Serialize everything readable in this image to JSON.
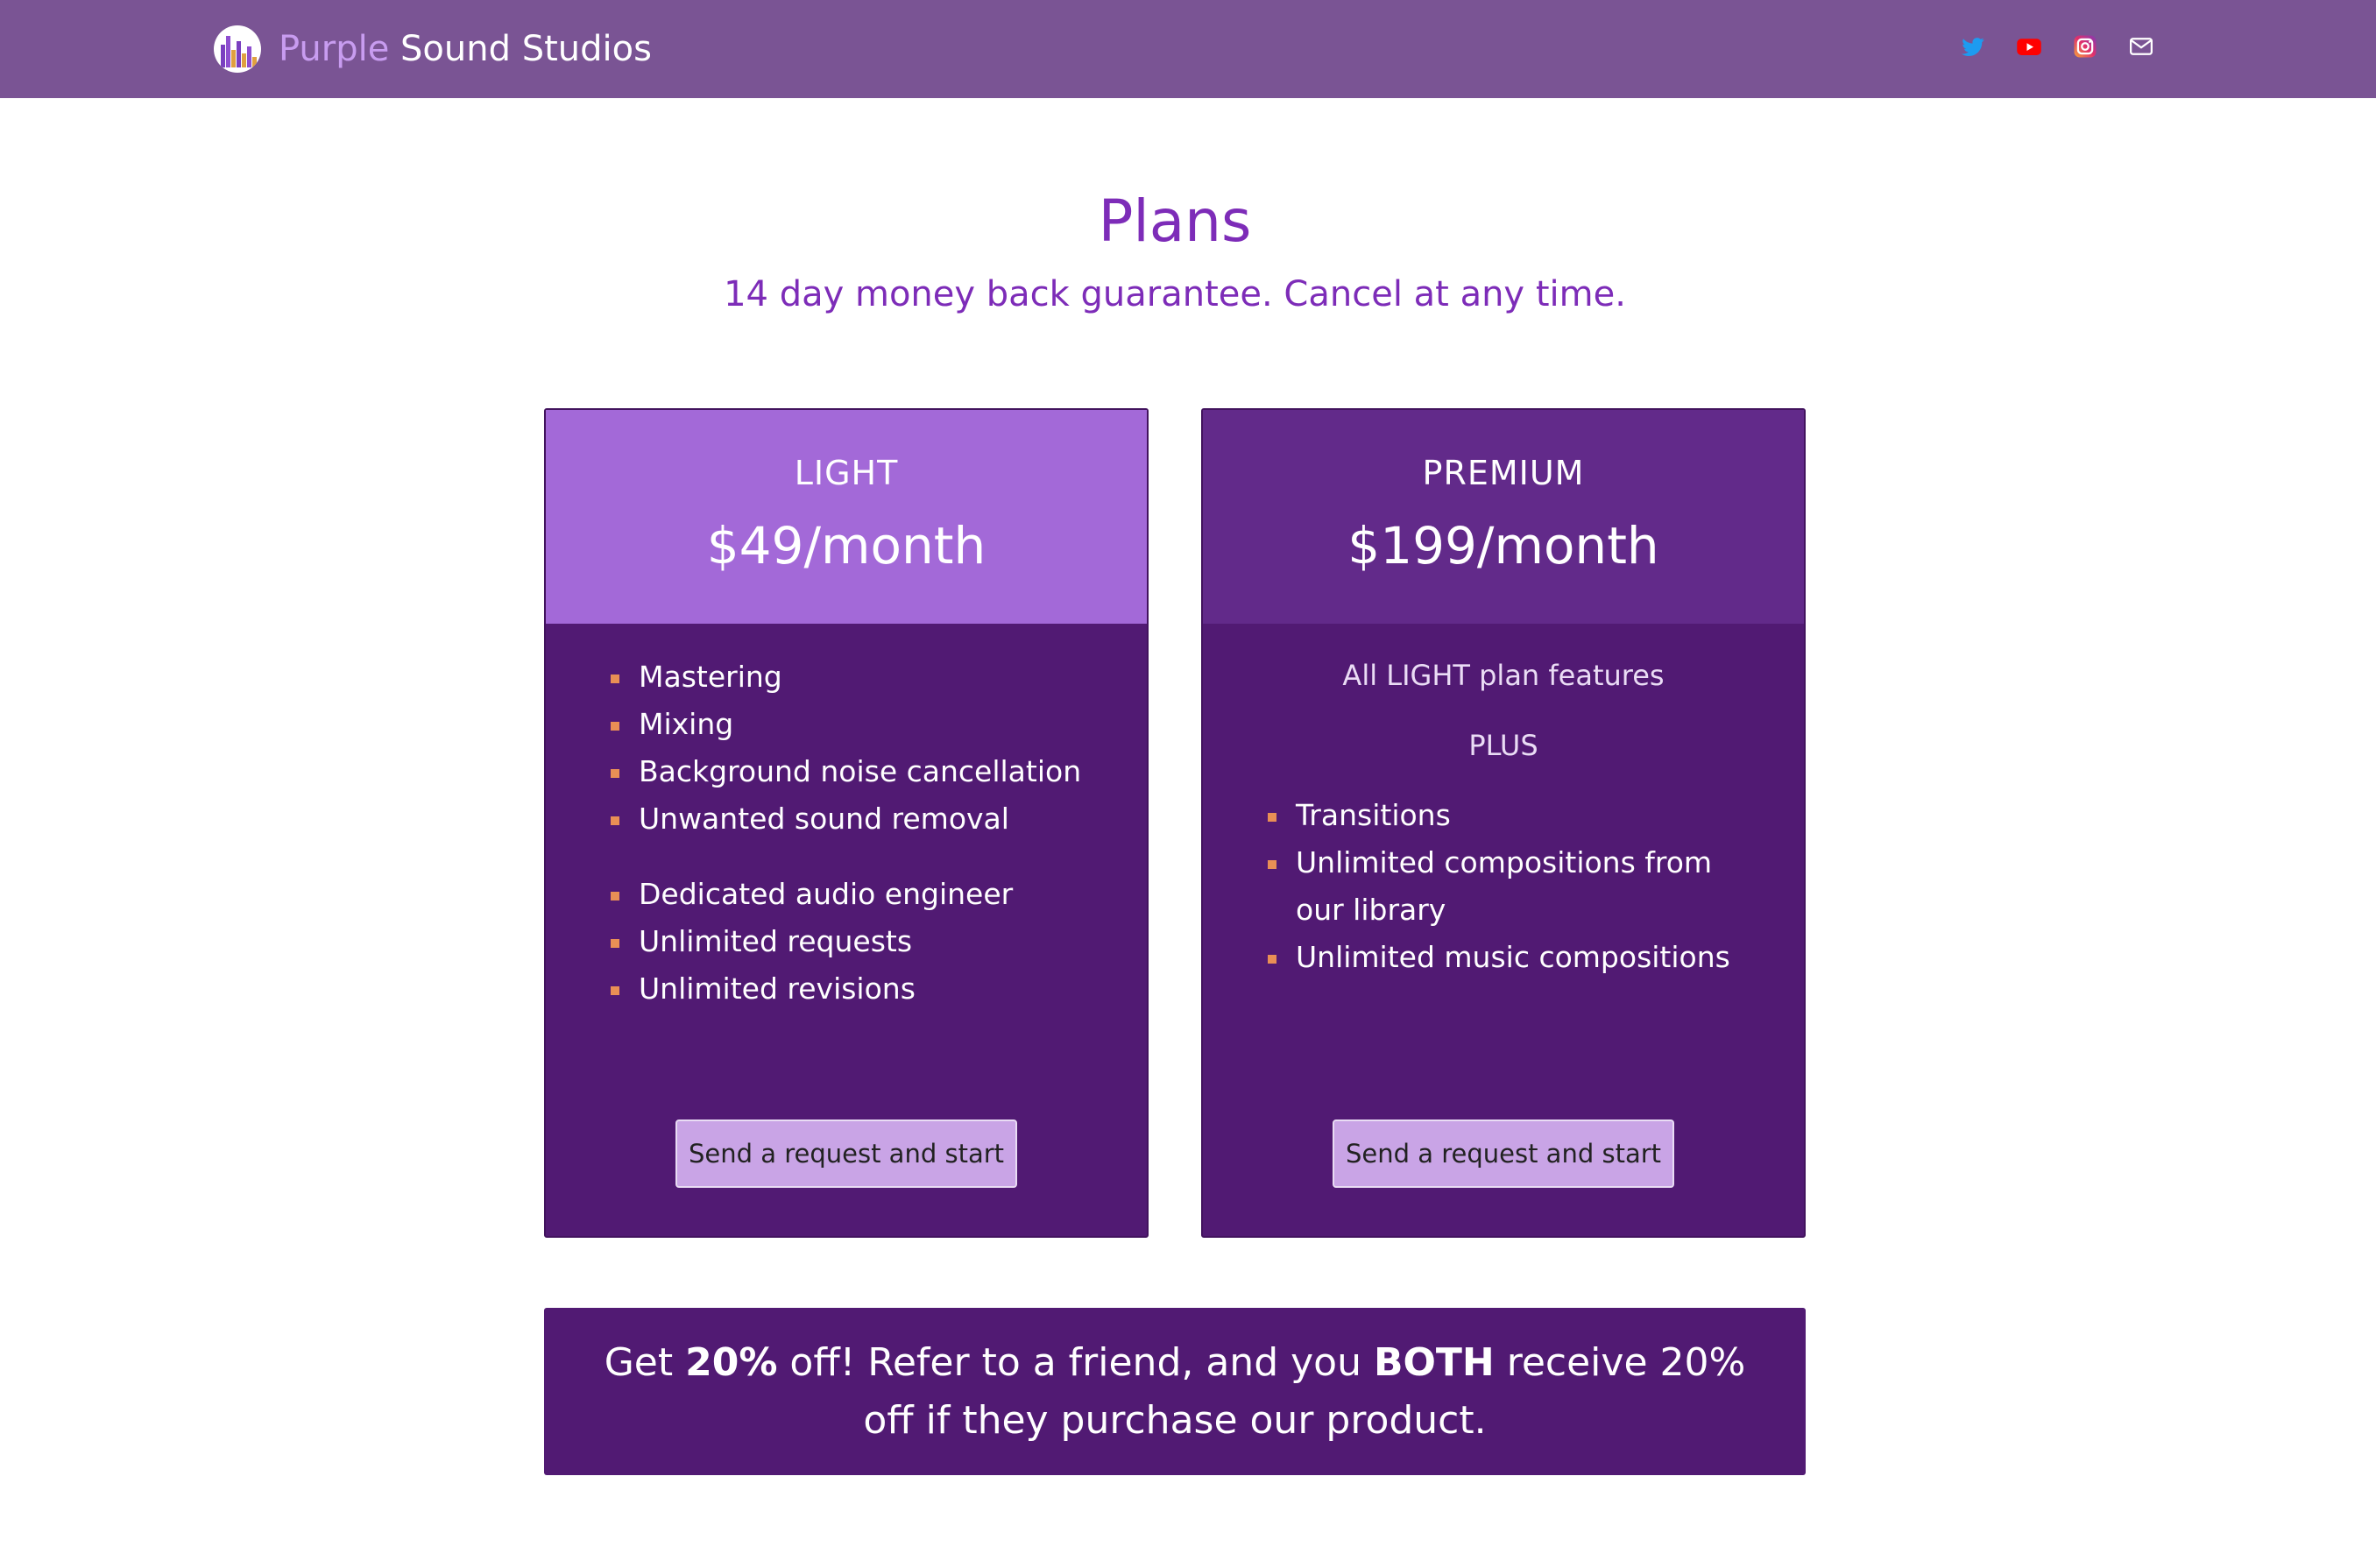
{
  "header": {
    "brand_accent": "Purple",
    "brand_rest": " Sound Studios",
    "socials": [
      "twitter-icon",
      "youtube-icon",
      "instagram-icon",
      "mail-icon"
    ]
  },
  "main": {
    "title": "Plans",
    "subtitle": "14 day money back guarantee. Cancel at any time."
  },
  "plans": [
    {
      "name": "LIGHT",
      "price": "$49/month",
      "features_group1": [
        "Mastering",
        "Mixing",
        "Background noise cancellation",
        "Unwanted sound removal"
      ],
      "features_group2": [
        "Dedicated audio engineer",
        "Unlimited requests",
        "Unlimited revisions"
      ],
      "button_label": "Send a request and start"
    },
    {
      "name": "PREMIUM",
      "price": "$199/month",
      "intro": "All LIGHT plan features",
      "plus": "PLUS",
      "features": [
        "Transitions",
        "Unlimited compositions from our library",
        "Unlimited music compositions"
      ],
      "button_label": "Send a request and start"
    }
  ],
  "promo": {
    "part1": "Get ",
    "discount1": "20%",
    "part2": " off! Refer to a friend, and you ",
    "both": "BOTH",
    "part3": " receive 20% off if they purchase our product."
  },
  "colors": {
    "navbar": "#7a5494",
    "title": "#7d2cb8",
    "card_body": "#511a73",
    "light_header": "#a369d8",
    "premium_header": "#622a8a",
    "button": "#c9a4e6",
    "bullet": "#e98f55"
  }
}
